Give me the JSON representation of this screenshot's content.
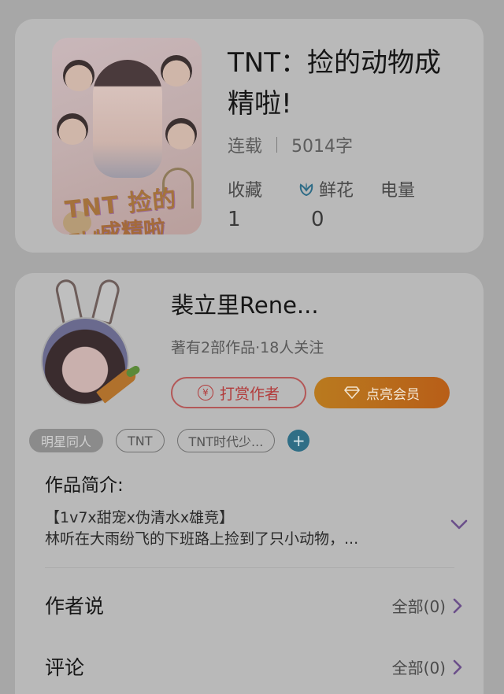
{
  "book": {
    "title": "TNT：捡的动物成精啦!",
    "status": "连载",
    "word_count": "5014字",
    "cover_art_text_1": "TNT",
    "cover_art_text_2": "捡的动物",
    "cover_art_text_3": "成精啦",
    "stats": [
      {
        "label": "收藏",
        "value": "1"
      },
      {
        "label": "鲜花",
        "value": "0",
        "icon": "flower-icon"
      },
      {
        "label": "电量",
        "value": ""
      }
    ]
  },
  "author": {
    "name": "裴立里Rene...",
    "summary": "著有2部作品·18人关注",
    "reward_label": "打赏作者",
    "reward_icon": "¥",
    "vip_label": "点亮会员"
  },
  "tags": [
    "明星同人",
    "TNT",
    "TNT时代少..."
  ],
  "tag_add_label": "+",
  "intro": {
    "label": "作品简介:",
    "line1": "【1v7x甜宠x伪清水x雄竞】",
    "line2": "林听在大雨纷飞的下班路上捡到了只小动物，..."
  },
  "rows": [
    {
      "label": "作者说",
      "action": "全部(0)"
    },
    {
      "label": "评论",
      "action": "全部(0)"
    }
  ],
  "colors": {
    "background": "#a7a7a7",
    "card": "#b9b9b9",
    "reward_accent": "#b23a3a",
    "vip_gradient_start": "#b97a1f",
    "vip_gradient_end": "#b85e18",
    "chevron": "#6b4f8a",
    "tag_add": "#2f6e86"
  }
}
